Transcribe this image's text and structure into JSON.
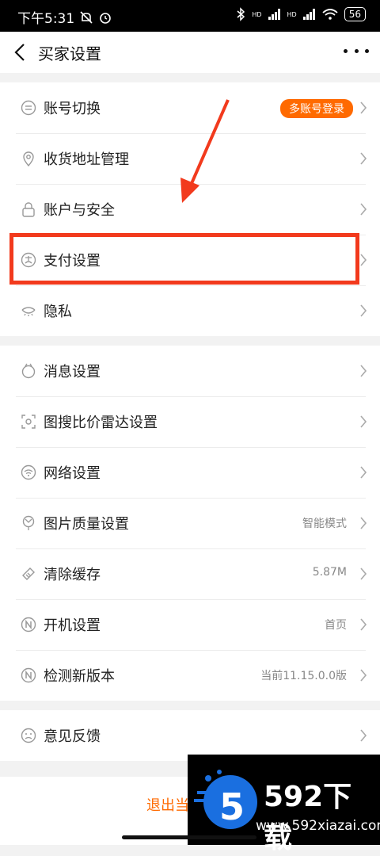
{
  "status_bar": {
    "time": "下午5:31",
    "battery": "56",
    "signal_badge_1": "HD",
    "signal_badge_2": "HD"
  },
  "header": {
    "title": "买家设置"
  },
  "group1": [
    {
      "label": "账号切换",
      "icon": "switch-account-icon",
      "badge": "多账号登录"
    },
    {
      "label": "收货地址管理",
      "icon": "location-pin-icon"
    },
    {
      "label": "账户与安全",
      "icon": "lock-icon"
    },
    {
      "label": "支付设置",
      "icon": "payment-icon"
    },
    {
      "label": "隐私",
      "icon": "eye-closed-icon"
    }
  ],
  "group2": [
    {
      "label": "消息设置",
      "icon": "message-icon"
    },
    {
      "label": "图搜比价雷达设置",
      "icon": "radar-scan-icon"
    },
    {
      "label": "网络设置",
      "icon": "wifi-icon"
    },
    {
      "label": "图片质量设置",
      "icon": "image-quality-icon",
      "value": "智能模式"
    },
    {
      "label": "清除缓存",
      "icon": "clear-cache-icon",
      "value": "5.87M"
    },
    {
      "label": "开机设置",
      "icon": "startup-n-icon",
      "value": "首页"
    },
    {
      "label": "检测新版本",
      "icon": "version-n-icon",
      "value": "当前11.15.0.0版"
    }
  ],
  "group3": [
    {
      "label": "意见反馈",
      "icon": "feedback-face-icon"
    }
  ],
  "logout": {
    "label": "退出当"
  },
  "watermark": {
    "brand": "592下载",
    "url": "www.592xiazai.com"
  },
  "colors": {
    "accent": "#ff6a00",
    "highlight": "#f23a1d"
  }
}
